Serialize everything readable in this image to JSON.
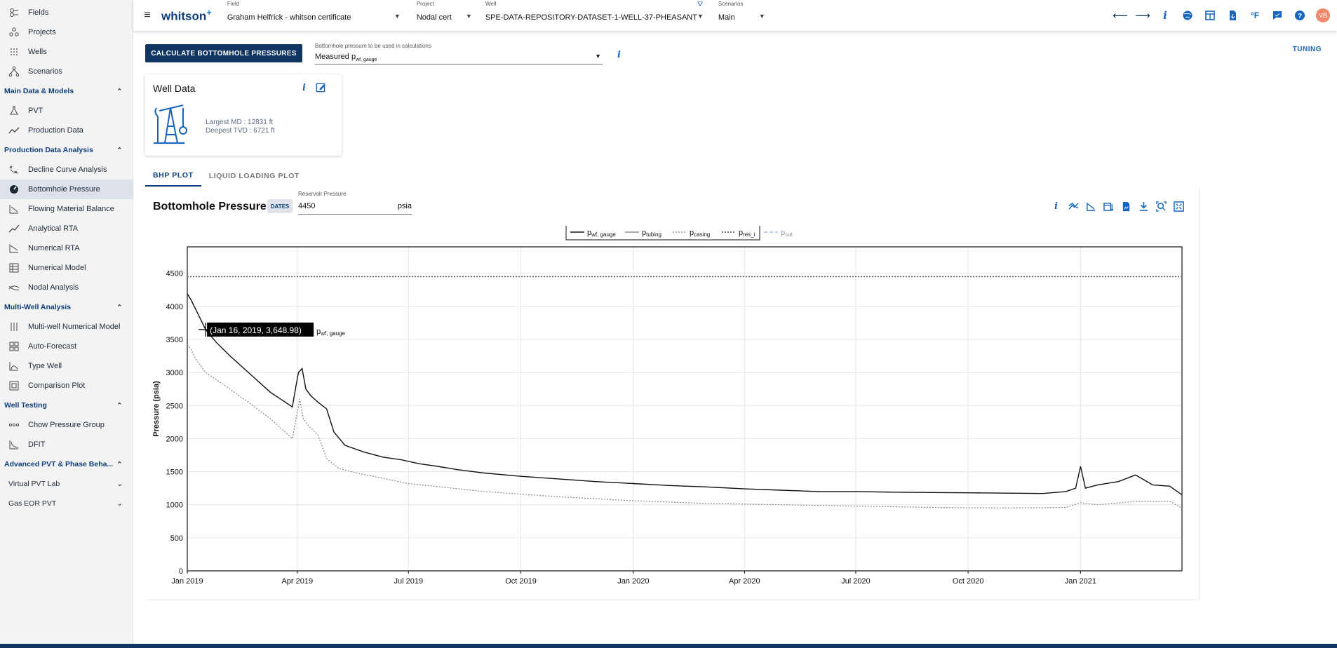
{
  "app": {
    "logo": "whitson",
    "logo_plus": "+"
  },
  "sidebar": {
    "items": [
      {
        "label": "Fields",
        "icon": "fields-icon"
      },
      {
        "label": "Projects",
        "icon": "projects-icon"
      },
      {
        "label": "Wells",
        "icon": "wells-icon"
      },
      {
        "label": "Scenarios",
        "icon": "scenarios-icon"
      }
    ],
    "sections": [
      {
        "title": "Main Data & Models",
        "items": [
          {
            "label": "PVT",
            "icon": "pvt-icon"
          },
          {
            "label": "Production Data",
            "icon": "production-data-icon"
          }
        ]
      },
      {
        "title": "Production Data Analysis",
        "items": [
          {
            "label": "Decline Curve Analysis",
            "icon": "dca-icon"
          },
          {
            "label": "Bottomhole Pressure",
            "icon": "gauge-icon",
            "active": true
          },
          {
            "label": "Flowing Material Balance",
            "icon": "fmb-icon"
          },
          {
            "label": "Analytical RTA",
            "icon": "analytical-rta-icon"
          },
          {
            "label": "Numerical RTA",
            "icon": "numerical-rta-icon"
          },
          {
            "label": "Numerical Model",
            "icon": "numerical-model-icon"
          },
          {
            "label": "Nodal Analysis",
            "icon": "nodal-analysis-icon"
          }
        ]
      },
      {
        "title": "Multi-Well Analysis",
        "items": [
          {
            "label": "Multi-well Numerical Model",
            "icon": "multiwell-icon"
          },
          {
            "label": "Auto-Forecast",
            "icon": "auto-forecast-icon"
          },
          {
            "label": "Type Well",
            "icon": "type-well-icon"
          },
          {
            "label": "Comparison Plot",
            "icon": "comparison-plot-icon"
          }
        ]
      },
      {
        "title": "Well Testing",
        "items": [
          {
            "label": "Chow Pressure Group",
            "icon": "chow-icon"
          },
          {
            "label": "DFIT",
            "icon": "dfit-icon"
          }
        ]
      }
    ],
    "advanced": "Advanced PVT & Phase Beha...",
    "virtual_lab": "Virtual PVT Lab",
    "gas_eor": "Gas EOR PVT"
  },
  "topbar": {
    "field_label": "Field",
    "field_value": "Graham Helfrick - whitson certificate",
    "project_label": "Project",
    "project_value": "Nodal cert",
    "well_label": "Well",
    "well_value": "SPE-DATA-REPOSITORY-DATASET-1-WELL-37-PHEASANT",
    "scenarios_label": "Scenarios",
    "scenarios_value": "Main",
    "units": "°F",
    "avatar": "VB"
  },
  "main": {
    "calc_button": "CALCULATE BOTTOMHOLE PRESSURES",
    "bhp_select_label": "Bottomhole pressure to be used in calculations",
    "bhp_select_value": "Measured p",
    "bhp_select_sub": "wf, gauge",
    "tuning": "TUNING",
    "well_card": {
      "title": "Well Data",
      "largest_md": "Largest MD :  12831 ft",
      "deepest_tvd": "Deepest TVD :  6721 ft"
    },
    "tabs": [
      "BHP PLOT",
      "LIQUID LOADING PLOT"
    ],
    "plot_title": "Bottomhole Pressure",
    "dates_badge": "DATES",
    "res_pressure_label": "Reservoir Pressure",
    "res_pressure_value": "4450",
    "res_pressure_unit": "psia"
  },
  "colors": {
    "primary": "#0f3563",
    "accent": "#1565c0",
    "pwf": "#111111",
    "pcasing": "#888888",
    "pres": "#666666",
    "psat": "#9fc3e6"
  },
  "chart_data": {
    "type": "line",
    "ylabel": "Pressure (psia)",
    "ylim": [
      0,
      4900
    ],
    "yticks": [
      0,
      500,
      1000,
      1500,
      2000,
      2500,
      3000,
      3500,
      4000,
      4500
    ],
    "xlim": [
      "2019-01-01",
      "2021-03-25"
    ],
    "xticks": [
      {
        "label": "Jan 2019",
        "date": "2019-01-01"
      },
      {
        "label": "Apr 2019",
        "date": "2019-04-01"
      },
      {
        "label": "Jul 2019",
        "date": "2019-07-01"
      },
      {
        "label": "Oct 2019",
        "date": "2019-10-01"
      },
      {
        "label": "Jan 2020",
        "date": "2020-01-01"
      },
      {
        "label": "Apr 2020",
        "date": "2020-04-01"
      },
      {
        "label": "Jul 2020",
        "date": "2020-07-01"
      },
      {
        "label": "Oct 2020",
        "date": "2020-10-01"
      },
      {
        "label": "Jan 2021",
        "date": "2021-01-01"
      }
    ],
    "legend": [
      {
        "label": "p",
        "sub": "wf, gauge",
        "style": "solid"
      },
      {
        "label": "p",
        "sub": "tubing",
        "style": "solid-light"
      },
      {
        "label": "p",
        "sub": "casing",
        "style": "dotted"
      },
      {
        "label": "p",
        "sub": "res_i",
        "style": "dotted-dark"
      },
      {
        "label": "p",
        "sub": "sat",
        "style": "dashed-blue"
      }
    ],
    "series": [
      {
        "name": "pwf, gauge",
        "x": [
          "2019-01-01",
          "2019-01-04",
          "2019-01-08",
          "2019-01-12",
          "2019-01-16",
          "2019-01-25",
          "2019-02-05",
          "2019-02-20",
          "2019-03-10",
          "2019-03-28",
          "2019-03-31",
          "2019-04-02",
          "2019-04-05",
          "2019-04-08",
          "2019-04-12",
          "2019-04-18",
          "2019-04-25",
          "2019-05-01",
          "2019-05-10",
          "2019-05-25",
          "2019-06-10",
          "2019-06-25",
          "2019-07-10",
          "2019-07-25",
          "2019-08-10",
          "2019-09-01",
          "2019-10-01",
          "2019-11-01",
          "2019-12-01",
          "2020-01-01",
          "2020-02-01",
          "2020-03-01",
          "2020-04-01",
          "2020-05-01",
          "2020-06-01",
          "2020-07-01",
          "2020-08-01",
          "2020-09-01",
          "2020-10-01",
          "2020-11-01",
          "2020-12-01",
          "2020-12-20",
          "2020-12-28",
          "2021-01-01",
          "2021-01-05",
          "2021-01-15",
          "2021-02-01",
          "2021-02-15",
          "2021-03-01",
          "2021-03-15",
          "2021-03-25"
        ],
        "y": [
          4190,
          4100,
          3950,
          3800,
          3649,
          3450,
          3250,
          3000,
          2700,
          2480,
          2800,
          3000,
          3060,
          2750,
          2650,
          2550,
          2450,
          2100,
          1900,
          1800,
          1720,
          1680,
          1620,
          1580,
          1530,
          1480,
          1430,
          1390,
          1350,
          1320,
          1290,
          1270,
          1240,
          1220,
          1200,
          1200,
          1190,
          1185,
          1180,
          1175,
          1170,
          1200,
          1250,
          1580,
          1250,
          1300,
          1350,
          1450,
          1300,
          1280,
          1150
        ]
      },
      {
        "name": "pcasing",
        "x": [
          "2019-01-01",
          "2019-01-04",
          "2019-01-08",
          "2019-01-16",
          "2019-02-01",
          "2019-02-20",
          "2019-03-10",
          "2019-03-28",
          "2019-04-01",
          "2019-04-03",
          "2019-04-06",
          "2019-04-10",
          "2019-04-18",
          "2019-04-25",
          "2019-05-05",
          "2019-05-20",
          "2019-06-10",
          "2019-07-01",
          "2019-08-01",
          "2019-09-01",
          "2019-10-01",
          "2019-11-01",
          "2019-12-01",
          "2020-01-01",
          "2020-03-01",
          "2020-05-01",
          "2020-07-01",
          "2020-09-01",
          "2020-11-01",
          "2020-12-20",
          "2021-01-01",
          "2021-01-15",
          "2021-02-15",
          "2021-03-15",
          "2021-03-25"
        ],
        "y": [
          3420,
          3350,
          3200,
          3000,
          2800,
          2550,
          2300,
          2000,
          2400,
          2600,
          2300,
          2200,
          2050,
          1700,
          1550,
          1480,
          1400,
          1320,
          1260,
          1200,
          1160,
          1120,
          1090,
          1060,
          1020,
          1000,
          980,
          960,
          950,
          960,
          1030,
          1000,
          1050,
          1050,
          950
        ]
      },
      {
        "name": "pres_i",
        "x": [
          "2019-01-01",
          "2021-03-25"
        ],
        "y": [
          4450,
          4450
        ]
      }
    ],
    "tooltip": {
      "text": "(Jan 16, 2019, 3,648.98)",
      "series": "p",
      "series_sub": "wf, gauge"
    }
  }
}
